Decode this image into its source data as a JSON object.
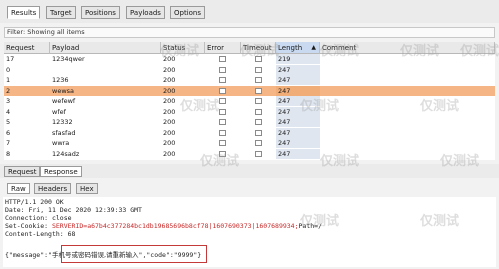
{
  "tabs": [
    "Results",
    "Target",
    "Positions",
    "Payloads",
    "Options"
  ],
  "active_tab": "Results",
  "filter_text": "Filter: Showing all items",
  "columns": [
    "Request",
    "Payload",
    "Status",
    "Error",
    "Timeout",
    "Length",
    "Comment"
  ],
  "sorted_column": "Length",
  "rows": [
    {
      "request": "17",
      "payload": "1234qwer",
      "status": "200",
      "length": "219",
      "selected": false
    },
    {
      "request": "0",
      "payload": "",
      "status": "200",
      "length": "247",
      "selected": false
    },
    {
      "request": "1",
      "payload": "1236",
      "status": "200",
      "length": "247",
      "selected": false
    },
    {
      "request": "2",
      "payload": "wewsa",
      "status": "200",
      "length": "247",
      "selected": true
    },
    {
      "request": "3",
      "payload": "wefewf",
      "status": "200",
      "length": "247",
      "selected": false
    },
    {
      "request": "4",
      "payload": "wfef",
      "status": "200",
      "length": "247",
      "selected": false
    },
    {
      "request": "5",
      "payload": "12332",
      "status": "200",
      "length": "247",
      "selected": false
    },
    {
      "request": "6",
      "payload": "sfasfad",
      "status": "200",
      "length": "247",
      "selected": false
    },
    {
      "request": "7",
      "payload": "wwra",
      "status": "200",
      "length": "247",
      "selected": false
    },
    {
      "request": "8",
      "payload": "124sadz",
      "status": "200",
      "length": "247",
      "selected": false
    }
  ],
  "req_resp_tabs": [
    "Request",
    "Response"
  ],
  "active_req_resp": "Response",
  "view_tabs": [
    "Raw",
    "Headers",
    "Hex"
  ],
  "active_view": "Raw",
  "response": {
    "status_line": "HTTP/1.1 200 OK",
    "date_line": "Date: Fri, 11 Dec 2020 12:39:33 GMT",
    "connection_line": "Connection: close",
    "cookie_label": "Set-Cookie: ",
    "cookie_value": "SERVERID=a67b4c377284bc1db19685696b8cf78|1607690373|1607689934;",
    "cookie_path": "Path=/",
    "length_line": "Content-Length: 68",
    "body_prefix": "{\"message\":\"",
    "body_message": "手机号或密码错误,请重新输入",
    "body_suffix": "\",\"code\":\"9999\"}"
  },
  "watermark": "仅测试"
}
